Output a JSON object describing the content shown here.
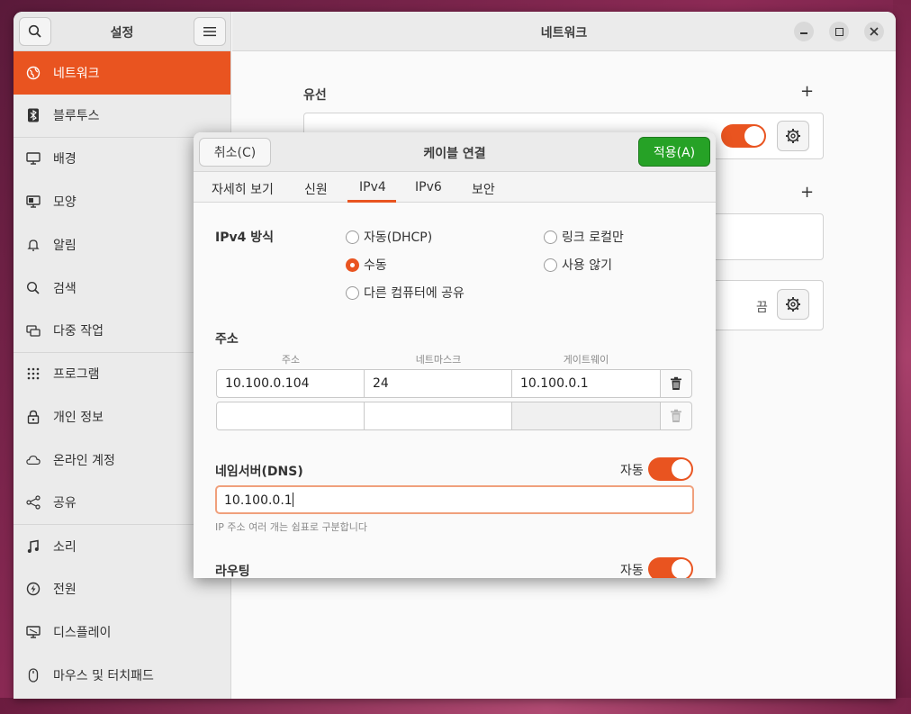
{
  "sidebar": {
    "title": "설정",
    "items": [
      {
        "label": "네트워크",
        "icon": "globe-icon"
      },
      {
        "label": "블루투스",
        "icon": "bluetooth-icon"
      },
      {
        "label": "배경",
        "icon": "monitor-icon"
      },
      {
        "label": "모양",
        "icon": "appearance-icon"
      },
      {
        "label": "알림",
        "icon": "bell-icon"
      },
      {
        "label": "검색",
        "icon": "search-icon"
      },
      {
        "label": "다중 작업",
        "icon": "multitask-icon"
      },
      {
        "label": "프로그램",
        "icon": "grid-icon"
      },
      {
        "label": "개인 정보",
        "icon": "lock-icon"
      },
      {
        "label": "온라인 계정",
        "icon": "cloud-icon"
      },
      {
        "label": "공유",
        "icon": "share-icon"
      },
      {
        "label": "소리",
        "icon": "music-icon"
      },
      {
        "label": "전원",
        "icon": "power-icon"
      },
      {
        "label": "디스플레이",
        "icon": "display-icon"
      },
      {
        "label": "마우스 및 터치패드",
        "icon": "mouse-icon"
      }
    ]
  },
  "main": {
    "title": "네트워크",
    "wired_label": "유선",
    "off_label": "끔"
  },
  "dialog": {
    "title": "케이블 연결",
    "cancel_label": "취소(C)",
    "apply_label": "적용(A)",
    "tabs": [
      "자세히 보기",
      "신원",
      "IPv4",
      "IPv6",
      "보안"
    ],
    "active_tab": "IPv4",
    "ipv4_method_label": "IPv4 방식",
    "methods": {
      "auto": "자동(DHCP)",
      "link_local": "링크 로컬만",
      "manual": "수동",
      "disable": "사용 않기",
      "share": "다른 컴퓨터에 공유"
    },
    "selected_method": "manual",
    "address_section": "주소",
    "address_columns": [
      "주소",
      "네트마스크",
      "게이트웨이"
    ],
    "address_rows": [
      {
        "address": "10.100.0.104",
        "netmask": "24",
        "gateway": "10.100.0.1"
      },
      {
        "address": "",
        "netmask": "",
        "gateway": ""
      }
    ],
    "dns_label": "네임서버(DNS)",
    "dns_auto_label": "자동",
    "dns_value": "10.100.0.1",
    "dns_hint": "IP 주소 여러 개는 쉼표로 구분합니다",
    "routing_label": "라우팅",
    "routing_auto_label": "자동"
  },
  "colors": {
    "accent": "#e95420",
    "apply": "#26a226"
  }
}
